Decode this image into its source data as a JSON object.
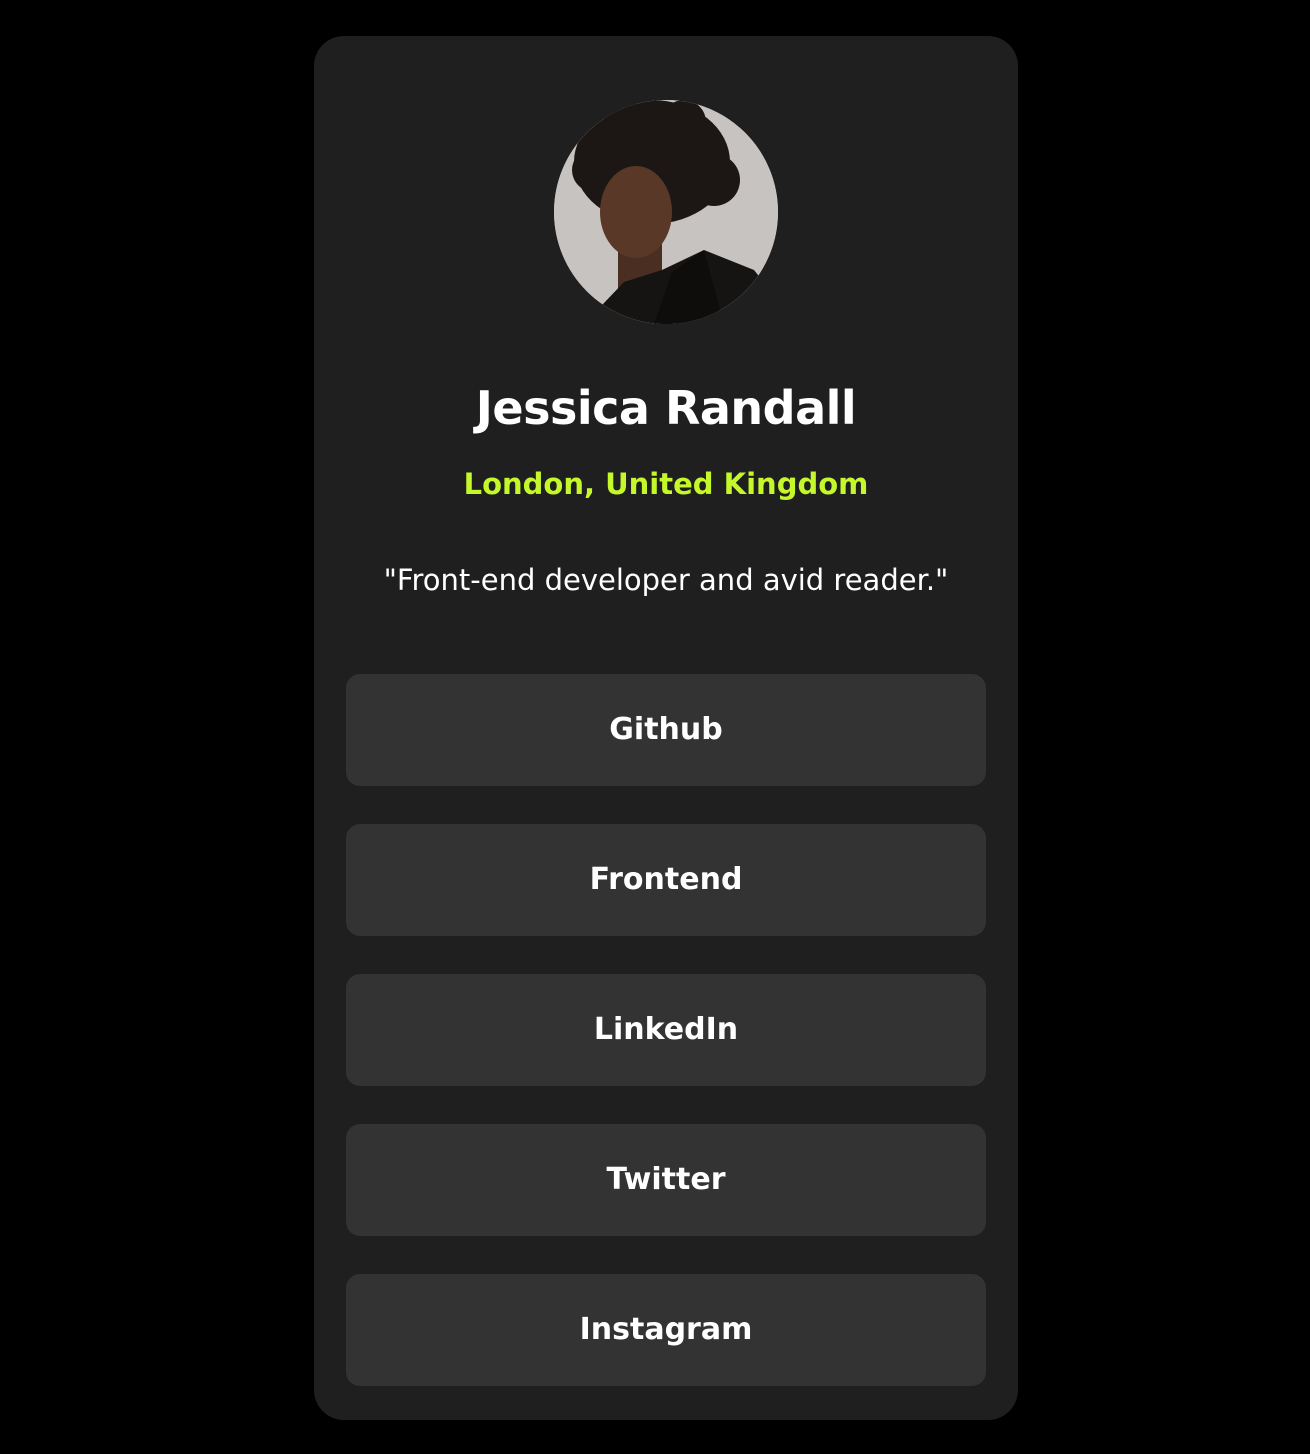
{
  "profile": {
    "name": "Jessica Randall",
    "location": "London, United Kingdom",
    "bio": "\"Front-end developer and avid reader.\""
  },
  "links": [
    {
      "label": "Github"
    },
    {
      "label": "Frontend"
    },
    {
      "label": "LinkedIn"
    },
    {
      "label": "Twitter"
    },
    {
      "label": "Instagram"
    }
  ],
  "colors": {
    "page_background": "#000000",
    "card_background": "#1f1f1f",
    "button_background": "#333333",
    "accent": "#c4f82a",
    "text": "#ffffff"
  }
}
